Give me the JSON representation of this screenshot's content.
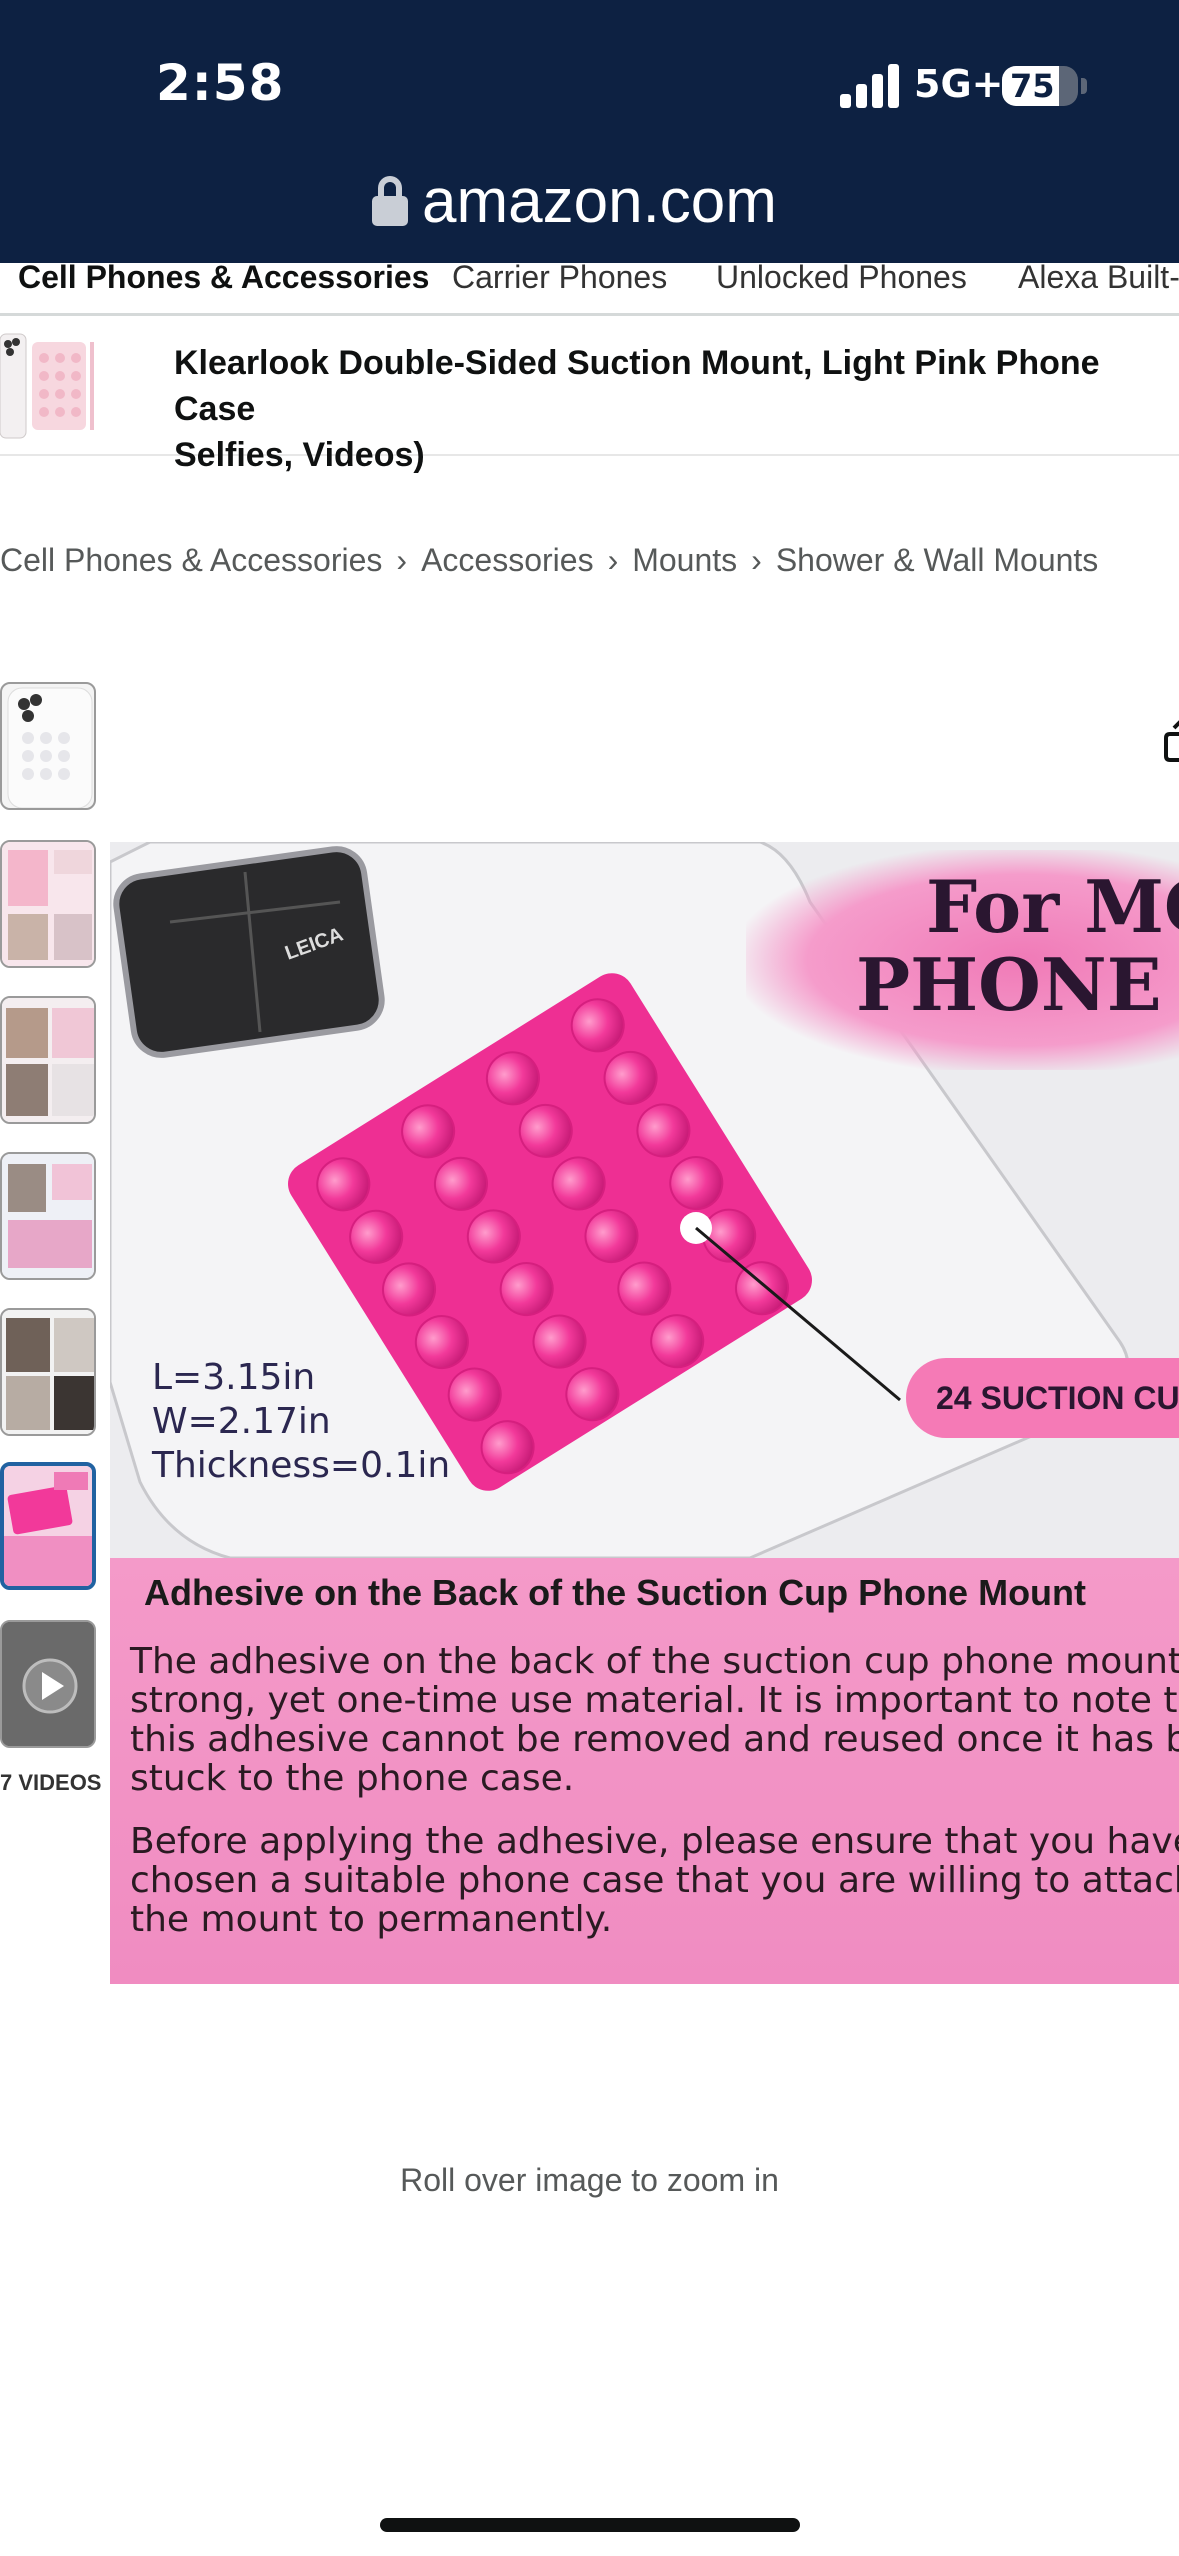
{
  "status_bar": {
    "time": "2:58",
    "network": "5G+",
    "battery_level": "75",
    "battery_fraction": 0.75
  },
  "browser": {
    "url": "amazon.com"
  },
  "category_nav": {
    "items": [
      "Cell Phones & Accessories",
      "Carrier Phones",
      "Unlocked Phones",
      "Alexa Built-"
    ]
  },
  "product": {
    "title": "Klearlook Double-Sided Suction Mount, Light Pink Phone Case",
    "title_cont": "Selfies, Videos)"
  },
  "breadcrumb": {
    "items": [
      "Cell Phones & Accessories",
      "Accessories",
      "Mounts",
      "Shower & Wall Mounts"
    ],
    "separator": "›"
  },
  "thumbnails": {
    "count_label": "7 VIDEOS"
  },
  "main_image": {
    "headline_1": "For MOST",
    "headline_2": "PHONE CAS",
    "phone_logo": "LEICA",
    "suction_label": "24 SUCTION CU",
    "dims": [
      "L=3.15in",
      "W=2.17in",
      "Thickness=0.1in"
    ],
    "panel_heading": "Adhesive on the Back of the Suction Cup Phone Mount",
    "para1": [
      "The adhesive on the back of the suction cup phone mount",
      "strong, yet one-time use material. It is important to note th",
      "this adhesive cannot be removed and reused once it has be",
      "stuck to the phone case."
    ],
    "para2": [
      "Before applying the adhesive, please ensure that you have",
      "chosen a suitable phone case that you are willing to attach",
      "the mount to permanently."
    ]
  },
  "zoom_hint": "Roll over image to zoom in",
  "colors": {
    "header_bg": "#0d2142",
    "pink": "#f2399a",
    "selected_thumb": "#2162a1"
  }
}
